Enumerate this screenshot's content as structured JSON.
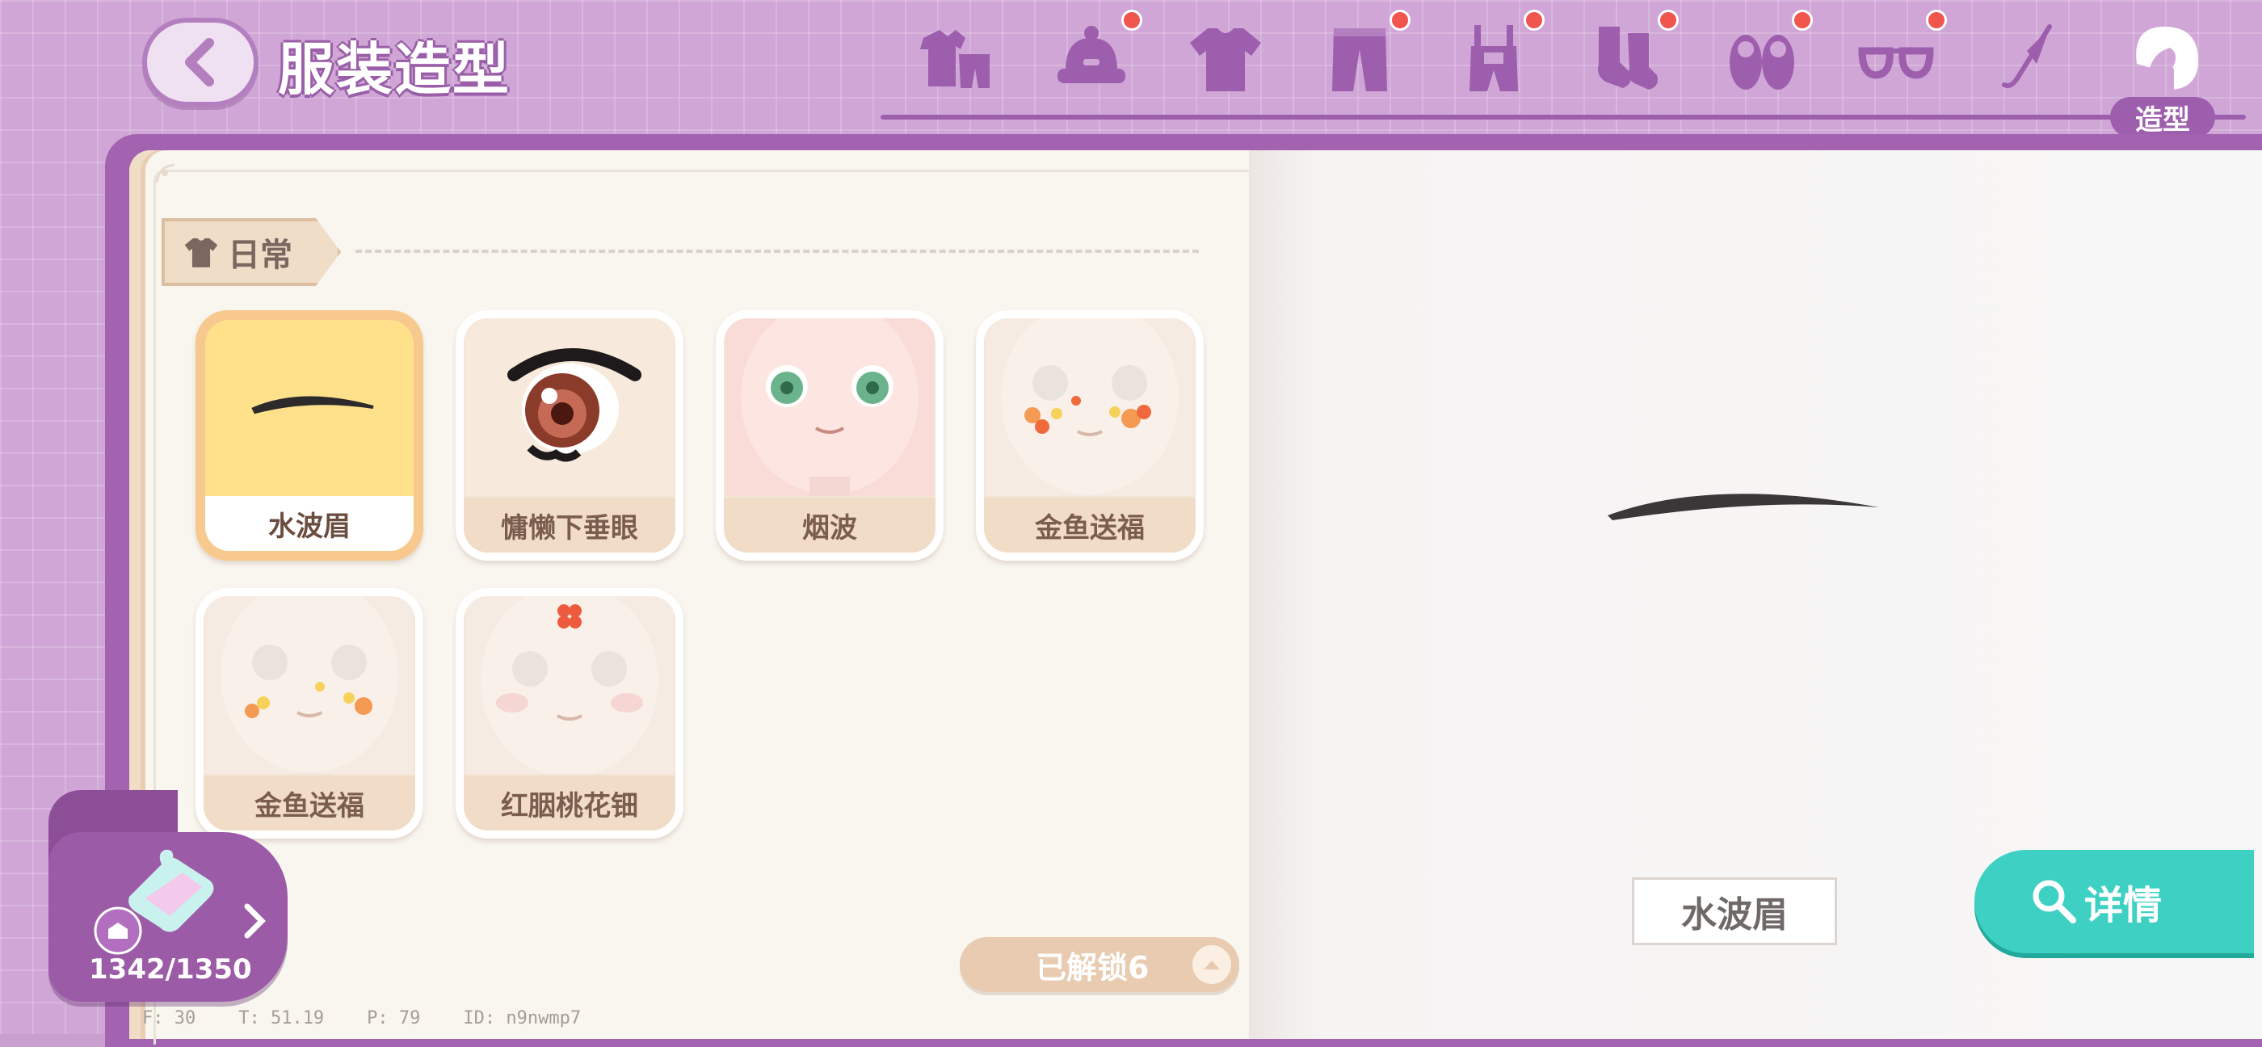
{
  "header": {
    "title": "服装造型",
    "active_tab_label": "造型"
  },
  "categories": [
    {
      "icon": "outfit-set-icon",
      "badge": false
    },
    {
      "icon": "hat-icon",
      "badge": true
    },
    {
      "icon": "shirt-icon",
      "badge": false
    },
    {
      "icon": "pants-icon",
      "badge": true
    },
    {
      "icon": "overalls-icon",
      "badge": true
    },
    {
      "icon": "socks-icon",
      "badge": true
    },
    {
      "icon": "shoes-icon",
      "badge": true
    },
    {
      "icon": "glasses-icon",
      "badge": true
    },
    {
      "icon": "umbrella-icon",
      "badge": false
    },
    {
      "icon": "hairstyle-icon",
      "badge": false,
      "active": true
    }
  ],
  "section": {
    "label": "日常"
  },
  "items": [
    {
      "name": "水波眉",
      "selected": true
    },
    {
      "name": "慵懒下垂眼",
      "selected": false
    },
    {
      "name": "烟波",
      "selected": false
    },
    {
      "name": "金鱼送福",
      "selected": false
    },
    {
      "name": "金鱼送福",
      "selected": false
    },
    {
      "name": "红胭桃花钿",
      "selected": false
    }
  ],
  "unlocked": {
    "label": "已解锁6"
  },
  "collection": {
    "count": "1342/1350"
  },
  "preview": {
    "name": "水波眉",
    "details_label": "详情"
  },
  "debug": {
    "f": "F: 30",
    "t": "T: 51.19",
    "p": "P: 79",
    "id": "ID: n9nwmp7"
  },
  "colors": {
    "accent_purple": "#9e5eae",
    "selected_orange": "#f8c98f",
    "details_teal": "#3ed1c3",
    "badge_red": "#f0554e"
  }
}
